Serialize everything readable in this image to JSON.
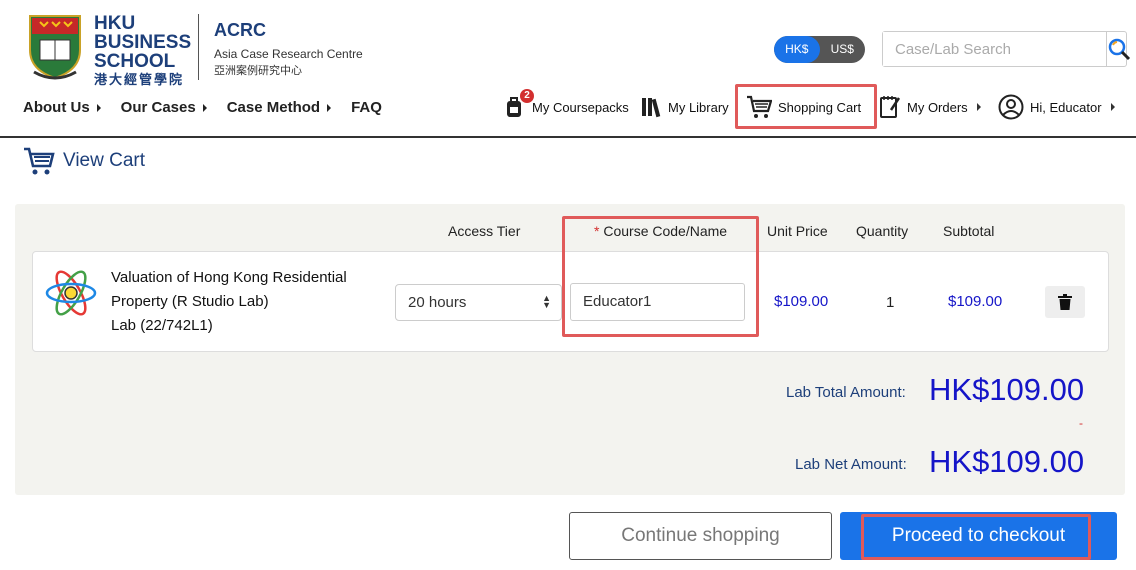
{
  "brand": {
    "school_lines": [
      "HKU",
      "BUSINESS",
      "SCHOOL"
    ],
    "school_cn": "港大經管學院",
    "acrc_title": "ACRC",
    "acrc_subtitle": "Asia Case Research Centre",
    "acrc_cn": "亞洲案例研究中心"
  },
  "currency": {
    "options": [
      "HK$",
      "US$"
    ],
    "selected": "HK$",
    "accent": "#1a73e8"
  },
  "search": {
    "placeholder": "Case/Lab Search"
  },
  "nav": [
    {
      "label": "About Us",
      "has_caret": true
    },
    {
      "label": "Our Cases",
      "has_caret": true
    },
    {
      "label": "Case Method",
      "has_caret": true
    },
    {
      "label": "FAQ",
      "has_caret": false
    }
  ],
  "utility": {
    "coursepacks": {
      "label": "My Coursepacks",
      "badge": "2",
      "icon": "backpack-icon"
    },
    "library": {
      "label": "My Library",
      "icon": "books-icon"
    },
    "cart": {
      "label": "Shopping Cart",
      "icon": "cart-icon"
    },
    "orders": {
      "label": "My Orders",
      "icon": "notepad-icon"
    },
    "account": {
      "label": "Hi, Educator",
      "icon": "user-circle-icon"
    }
  },
  "page": {
    "title": "View Cart"
  },
  "table": {
    "headers": {
      "access_tier": "Access Tier",
      "course_code_required": "*",
      "course_code": "Course Code/Name",
      "unit_price": "Unit Price",
      "quantity": "Quantity",
      "subtotal": "Subtotal"
    },
    "item": {
      "title_line1": "Valuation of Hong Kong Residential",
      "title_line2": "Property (R Studio Lab)",
      "type_code": "Lab (22/742L1)",
      "icon": "atom-icon",
      "access_tier": "20 hours",
      "course_code": "Educator1",
      "unit_price": "$109.00",
      "quantity": "1",
      "subtotal": "$109.00"
    }
  },
  "totals": {
    "total_label": "Lab Total Amount:",
    "total_value": "HK$109.00",
    "discount": "-",
    "net_label": "Lab Net Amount:",
    "net_value": "HK$109.00"
  },
  "actions": {
    "continue": "Continue shopping",
    "checkout": "Proceed to checkout"
  }
}
